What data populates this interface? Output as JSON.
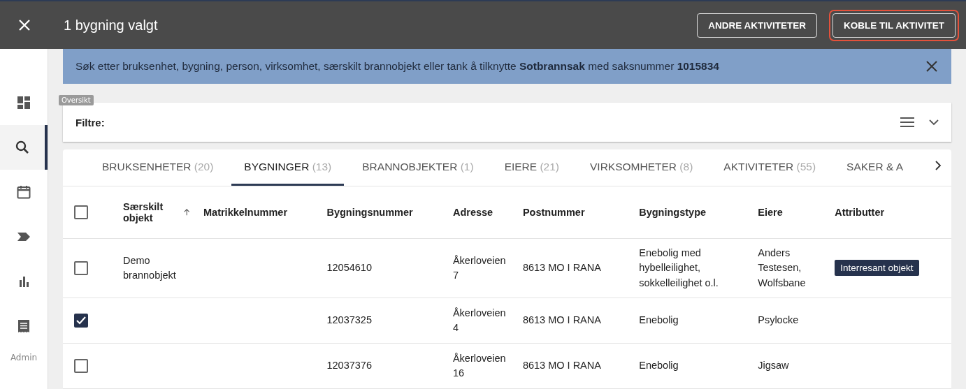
{
  "topbar": {
    "title": "1 bygning valgt",
    "buttons": [
      {
        "label": "ANDRE AKTIVITETER",
        "highlighted": false
      },
      {
        "label": "KOBLE TIL AKTIVITET",
        "highlighted": true
      }
    ]
  },
  "sidebar": {
    "items": [
      {
        "kind": "dashboard",
        "selected": false
      },
      {
        "kind": "search",
        "selected": true
      },
      {
        "kind": "calendar",
        "selected": false
      },
      {
        "kind": "tag",
        "selected": false
      },
      {
        "kind": "chart",
        "selected": false
      },
      {
        "kind": "receipt",
        "selected": false
      }
    ],
    "footer": "Admin",
    "tooltip": "Oversikt"
  },
  "banner": {
    "text": "Søk etter bruksenhet, bygning, person, virksomhet, særskilt brannobjekt eller tank å tilknytte **Sotbrannsak** med saksnummer **1015834**"
  },
  "filter": {
    "label": "Filtre:"
  },
  "tabs": [
    {
      "label": "BRUKSENHETER",
      "count": "(20)",
      "selected": false
    },
    {
      "label": "BYGNINGER",
      "count": "(13)",
      "selected": true
    },
    {
      "label": "BRANNOBJEKTER",
      "count": "(1)",
      "selected": false
    },
    {
      "label": "EIERE",
      "count": "(21)",
      "selected": false
    },
    {
      "label": "VIRKSOMHETER",
      "count": "(8)",
      "selected": false
    },
    {
      "label": "AKTIVITETER",
      "count": "(55)",
      "selected": false
    },
    {
      "label": "SAKER & A",
      "selected": false
    }
  ],
  "table": {
    "select_all_checked": false,
    "columns": [
      "Særskilt objekt",
      "Matrikkelnummer",
      "Bygningsnummer",
      "Adresse",
      "Postnummer",
      "Bygningstype",
      "Eiere",
      "Attributter"
    ],
    "rows": [
      {
        "checked": false,
        "cells": [
          "Demo brannobjekt",
          "",
          "12054610",
          "Åkerloveien 7",
          "8613 MO I RANA",
          "Enebolig med hybelleilighet, sokkelleilighet o.l.",
          "Anders Testesen, Wolfsbane"
        ],
        "tags": [
          "Interresant objekt"
        ]
      },
      {
        "checked": true,
        "cells": [
          "",
          "",
          "12037325",
          "Åkerloveien 4",
          "8613 MO I RANA",
          "Enebolig",
          "Psylocke"
        ]
      },
      {
        "checked": false,
        "cells": [
          "",
          "",
          "12037376",
          "Åkerloveien 16",
          "8613 MO I RANA",
          "Enebolig",
          "Jigsaw"
        ]
      }
    ]
  }
}
